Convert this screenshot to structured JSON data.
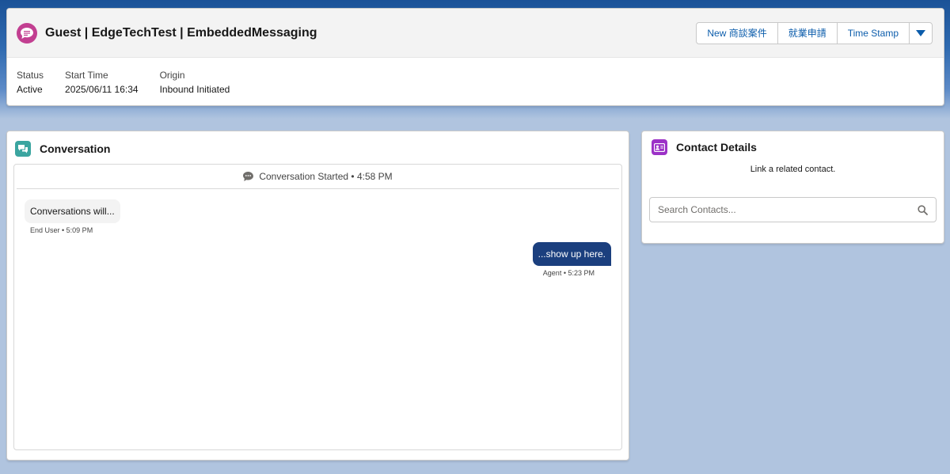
{
  "header": {
    "title": "Guest | EdgeTechTest | EmbeddedMessaging",
    "icon": "messaging-icon",
    "buttons": [
      {
        "label": "New 商談案件"
      },
      {
        "label": "就業申請"
      },
      {
        "label": "Time Stamp"
      }
    ],
    "fields": [
      {
        "label": "Status",
        "value": "Active"
      },
      {
        "label": "Start Time",
        "value": "2025/06/11 16:34"
      },
      {
        "label": "Origin",
        "value": "Inbound Initiated"
      }
    ]
  },
  "conversation": {
    "title": "Conversation",
    "started_label": "Conversation Started • 4:58 PM",
    "messages": [
      {
        "text": "Conversations will...",
        "meta": "End User • 5:09 PM",
        "direction": "inbound"
      },
      {
        "text": "...show up here.",
        "meta": "Agent • 5:23 PM",
        "direction": "outbound"
      }
    ]
  },
  "contact": {
    "title": "Contact Details",
    "hint": "Link a related contact.",
    "search_placeholder": "Search Contacts..."
  },
  "colors": {
    "brand": "#0b5cab",
    "agent_bubble": "#1b3f7e",
    "messaging_icon": "#c23f91",
    "conversation_icon": "#3ba5a0",
    "contact_icon": "#9c32c7"
  }
}
